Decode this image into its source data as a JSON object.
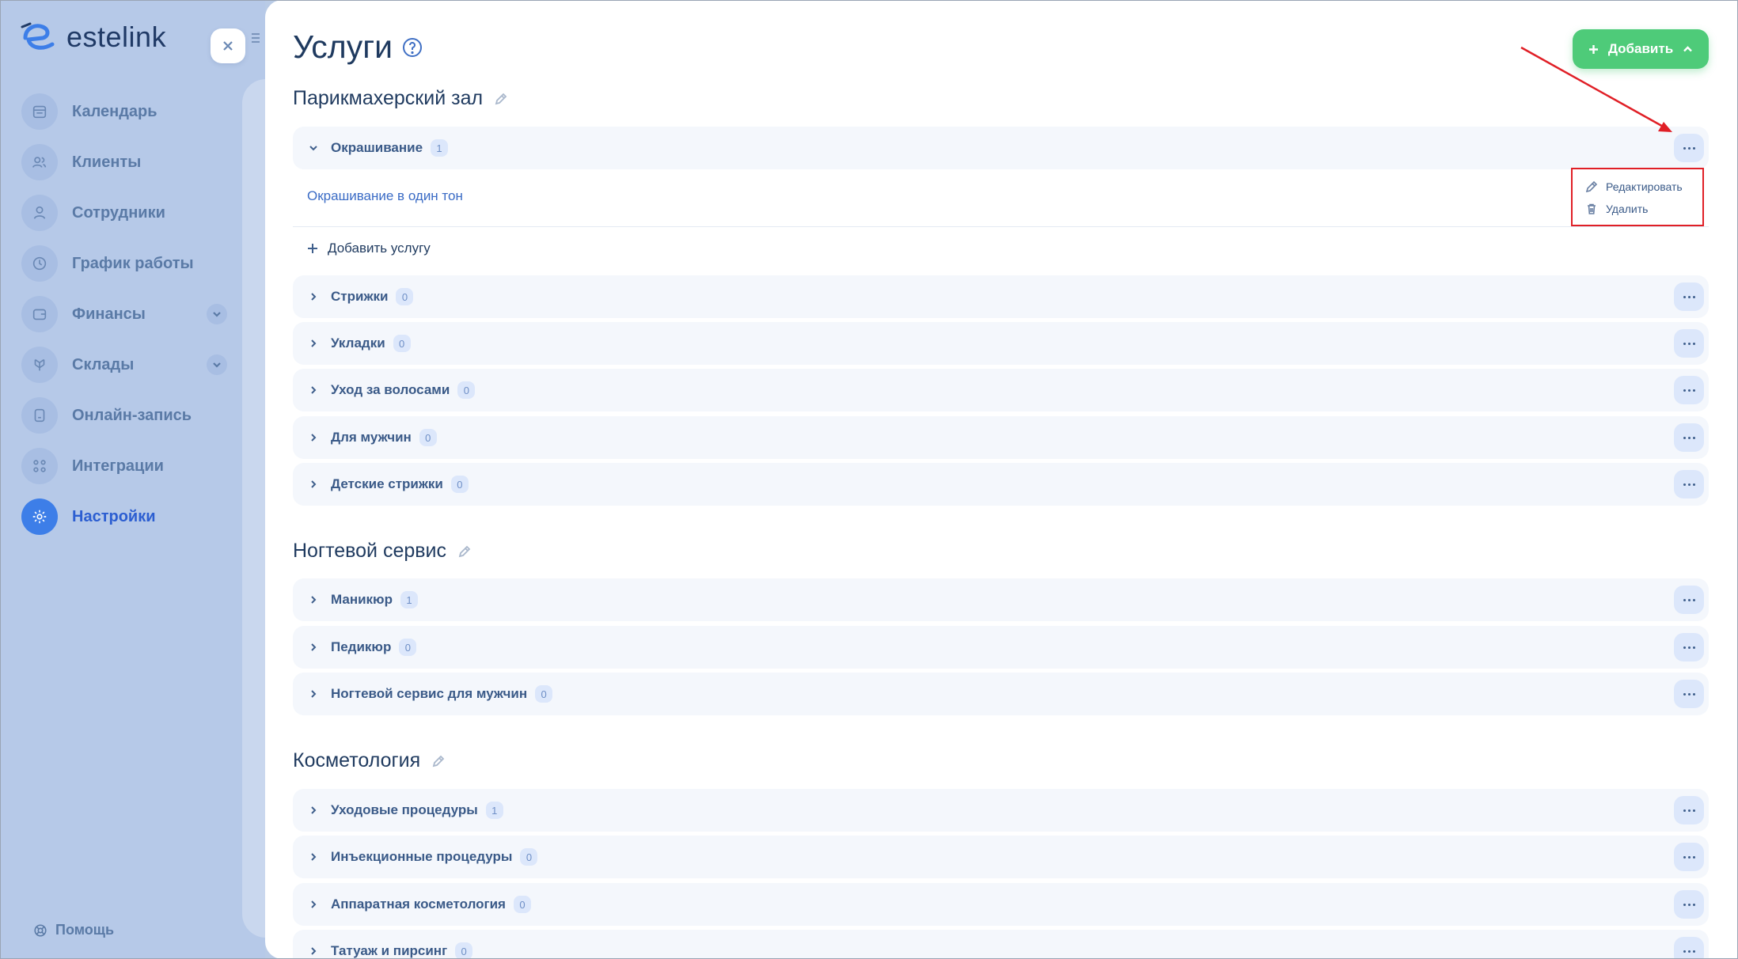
{
  "brand": {
    "name": "estelink"
  },
  "sidebar": {
    "items": [
      {
        "label": "Календарь",
        "icon": "calendar-icon"
      },
      {
        "label": "Клиенты",
        "icon": "clients-icon"
      },
      {
        "label": "Сотрудники",
        "icon": "staff-icon"
      },
      {
        "label": "График работы",
        "icon": "clock-icon"
      },
      {
        "label": "Финансы",
        "icon": "wallet-icon",
        "has_submenu": true
      },
      {
        "label": "Склады",
        "icon": "warehouse-icon",
        "has_submenu": true
      },
      {
        "label": "Онлайн-запись",
        "icon": "booking-icon"
      },
      {
        "label": "Интеграции",
        "icon": "integrations-icon"
      },
      {
        "label": "Настройки",
        "icon": "settings-icon",
        "active": true
      }
    ],
    "help_label": "Помощь"
  },
  "page": {
    "title": "Услуги",
    "add_button_label": "Добавить"
  },
  "groups": [
    {
      "title": "Парикмахерский зал",
      "categories": [
        {
          "name": "Окрашивание",
          "count": "1",
          "expanded": true
        },
        {
          "name": "Стрижки",
          "count": "0"
        },
        {
          "name": "Укладки",
          "count": "0"
        },
        {
          "name": "Уход за волосами",
          "count": "0"
        },
        {
          "name": "Для мужчин",
          "count": "0"
        },
        {
          "name": "Детские стрижки",
          "count": "0"
        }
      ],
      "expanded_service": "Окрашивание в один тон",
      "add_service_label": "Добавить услугу"
    },
    {
      "title": "Ногтевой сервис",
      "categories": [
        {
          "name": "Маникюр",
          "count": "1"
        },
        {
          "name": "Педикюр",
          "count": "0"
        },
        {
          "name": "Ногтевой сервис для мужчин",
          "count": "0"
        }
      ]
    },
    {
      "title": "Косметология",
      "categories": [
        {
          "name": "Уходовые процедуры",
          "count": "1"
        },
        {
          "name": "Инъекционные процедуры",
          "count": "0"
        },
        {
          "name": "Аппаратная косметология",
          "count": "0"
        },
        {
          "name": "Татуаж и пирсинг",
          "count": "0"
        }
      ]
    }
  ],
  "context_menu": {
    "edit_label": "Редактировать",
    "delete_label": "Удалить"
  },
  "colors": {
    "accent": "#3d7ee8",
    "add_button": "#4ecb79",
    "highlight": "#e01f26"
  }
}
